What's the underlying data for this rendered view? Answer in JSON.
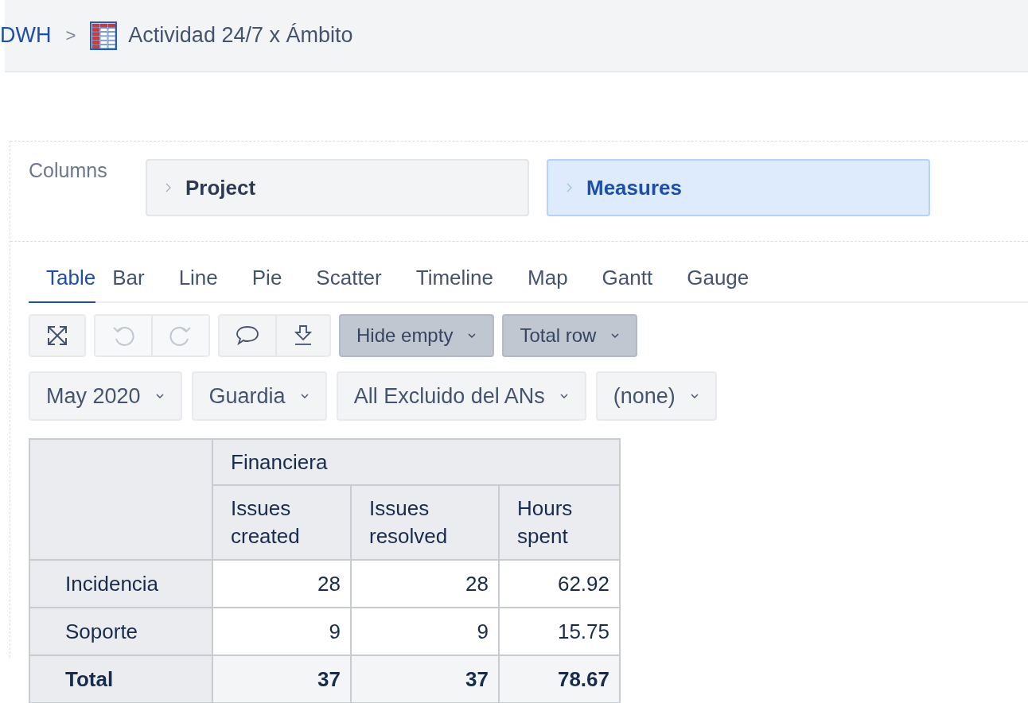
{
  "breadcrumb": {
    "parent": "DWH",
    "separator": ">",
    "title": "Actividad 24/7 x Ámbito"
  },
  "columns": {
    "label": "Columns",
    "chips": [
      {
        "label": "Project",
        "selected": false
      },
      {
        "label": "Measures",
        "selected": true
      }
    ]
  },
  "tabs": [
    {
      "label": "Table",
      "selected": true
    },
    {
      "label": "Bar",
      "selected": false
    },
    {
      "label": "Line",
      "selected": false
    },
    {
      "label": "Pie",
      "selected": false
    },
    {
      "label": "Scatter",
      "selected": false
    },
    {
      "label": "Timeline",
      "selected": false
    },
    {
      "label": "Map",
      "selected": false
    },
    {
      "label": "Gantt",
      "selected": false
    },
    {
      "label": "Gauge",
      "selected": false
    }
  ],
  "toolbar": {
    "undo_disabled": true,
    "redo_disabled": true,
    "toggles": [
      {
        "label": "Hide empty",
        "on": true
      },
      {
        "label": "Total row",
        "on": true
      }
    ]
  },
  "filters": [
    {
      "label": "May 2020"
    },
    {
      "label": "Guardia"
    },
    {
      "label": "All Excluido del ANs"
    },
    {
      "label": "(none)"
    }
  ],
  "table": {
    "group": "Financiera",
    "columns": [
      "Issues created",
      "Issues resolved",
      "Hours spent"
    ],
    "rows": [
      {
        "label": "Incidencia",
        "kind": "data",
        "values": [
          "28",
          "28",
          "62.92"
        ]
      },
      {
        "label": "Soporte",
        "kind": "data",
        "values": [
          "9",
          "9",
          "15.75"
        ]
      },
      {
        "label": "Total",
        "kind": "total",
        "values": [
          "37",
          "37",
          "78.67"
        ]
      }
    ]
  }
}
